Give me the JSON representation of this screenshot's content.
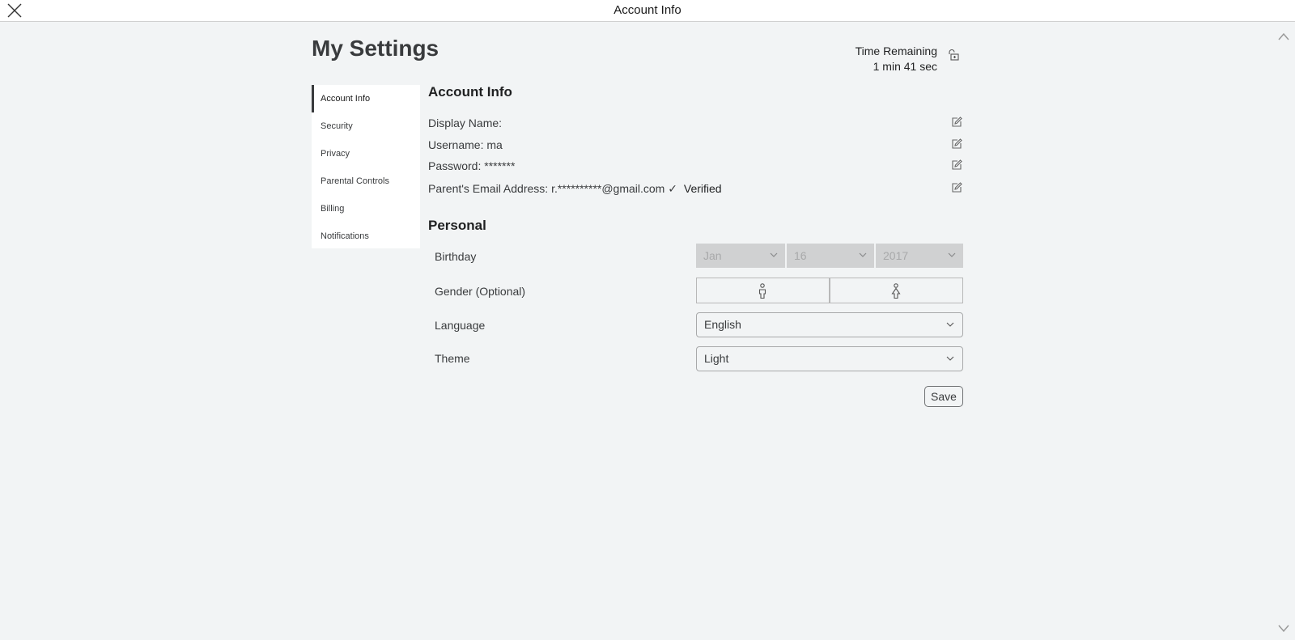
{
  "window": {
    "title": "Account Info"
  },
  "page": {
    "title": "My Settings"
  },
  "timer": {
    "label": "Time Remaining",
    "value": "1 min 41 sec"
  },
  "sidebar": {
    "items": [
      {
        "label": "Account Info",
        "active": true
      },
      {
        "label": "Security"
      },
      {
        "label": "Privacy"
      },
      {
        "label": "Parental Controls"
      },
      {
        "label": "Billing"
      },
      {
        "label": "Notifications"
      }
    ]
  },
  "account": {
    "title": "Account Info",
    "display_name_label": "Display Name:",
    "display_name_value": "",
    "username_label": "Username:",
    "username_value": "ma",
    "password_label": "Password:",
    "password_value": "*******",
    "email_label": "Parent's Email Address:",
    "email_value": "r.**********@gmail.com",
    "verified_check": "✓",
    "verified_label": "Verified"
  },
  "personal": {
    "title": "Personal",
    "birthday_label": "Birthday",
    "birthday_month": "Jan",
    "birthday_day": "16",
    "birthday_year": "2017",
    "gender_label": "Gender (Optional)",
    "language_label": "Language",
    "language_value": "English",
    "theme_label": "Theme",
    "theme_value": "Light",
    "save_label": "Save"
  },
  "colors": {
    "background": "#f2f4f5",
    "text": "#393b3d",
    "disabled_select": "#d0d1d2"
  }
}
